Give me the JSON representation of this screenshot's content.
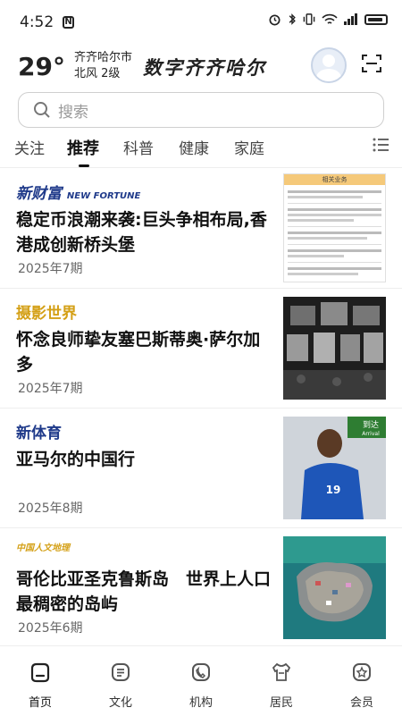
{
  "status": {
    "time": "4:52",
    "extra_icon": "N"
  },
  "weather": {
    "temperature": "29°",
    "city": "齐齐哈尔市",
    "wind": "北风 2级"
  },
  "app_title": "数字齐齐哈尔",
  "search": {
    "placeholder": "搜索"
  },
  "tabs": [
    "关注",
    "推荐",
    "科普",
    "健康",
    "家庭"
  ],
  "active_tab_index": 1,
  "articles": [
    {
      "brand": "新财富",
      "brand_en": "NEW FORTUNE",
      "brand_color": "#1f3a8a",
      "title": "稳定币浪潮来袭:巨头争相布局,香港成创新桥头堡",
      "date": "2025年7期",
      "thumb_header": "相关业务"
    },
    {
      "brand": "摄影世界",
      "brand_color": "#d4a017",
      "title": "怀念良师挚友塞巴斯蒂奥·萨尔加多",
      "date": "2025年7期"
    },
    {
      "brand": "新体育",
      "brand_color": "#1f3a8a",
      "title": "亚马尔的中国行",
      "date": "2025年8期",
      "thumb_sign": "到达",
      "thumb_sign_en": "Arrival",
      "jersey_number": "19"
    },
    {
      "brand": "中国人文地理",
      "brand_color": "#d4a017",
      "title": "哥伦比亚圣克鲁斯岛　世界上人口最稠密的岛屿",
      "date": "2025年6期"
    }
  ],
  "bottom_nav": [
    {
      "label": "首页",
      "icon": "home-icon",
      "active": true
    },
    {
      "label": "文化",
      "icon": "book-icon",
      "active": false
    },
    {
      "label": "机构",
      "icon": "phone-icon",
      "active": false
    },
    {
      "label": "居民",
      "icon": "shirt-icon",
      "active": false
    },
    {
      "label": "会员",
      "icon": "member-icon",
      "active": false
    }
  ],
  "colors": {
    "accent": "#111111",
    "muted": "#9a9a9a",
    "divider": "#eeeeee"
  }
}
